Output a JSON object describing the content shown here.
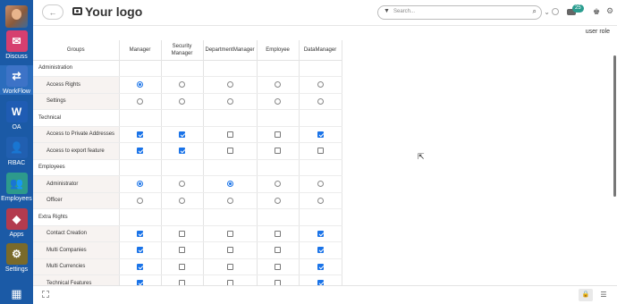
{
  "sidebar": {
    "apps": [
      {
        "label": "Discuss",
        "icon": "discuss-icon",
        "color": "#d63f6f",
        "glyph": "✉"
      },
      {
        "label": "WorkFlow",
        "icon": "workflow-icon",
        "color": "#3d73c7",
        "glyph": "⇄"
      },
      {
        "label": "OA",
        "icon": "word-icon",
        "color": "#1f5cb3",
        "glyph": "W"
      },
      {
        "label": "RBAC",
        "icon": "person-icon",
        "color": "#215fb0",
        "glyph": "👤"
      },
      {
        "label": "Employees",
        "icon": "employees-icon",
        "color": "#2d9a8c",
        "glyph": "👥"
      },
      {
        "label": "Apps",
        "icon": "apps-icon",
        "color": "#b33b4e",
        "glyph": "◆"
      },
      {
        "label": "Settings",
        "icon": "settings-icon",
        "color": "#7a6a2a",
        "glyph": "⚙"
      }
    ]
  },
  "topbar": {
    "logo": "Your logo",
    "search_placeholder": "Search...",
    "badge_count": "25"
  },
  "page": {
    "title": "user role"
  },
  "table": {
    "headers": [
      "Groups",
      "Manager",
      "Security Manager",
      "DepartmentManager",
      "Employee",
      "DataManager"
    ],
    "rows": [
      {
        "label": "Administration",
        "type": "group"
      },
      {
        "label": "Access Rights",
        "type": "radio",
        "values": [
          1,
          0,
          0,
          0,
          0
        ]
      },
      {
        "label": "Settings",
        "type": "radio",
        "values": [
          0,
          0,
          0,
          0,
          0
        ]
      },
      {
        "label": "Technical",
        "type": "group"
      },
      {
        "label": "Access to Private Addresses",
        "type": "check",
        "values": [
          1,
          1,
          0,
          0,
          1
        ]
      },
      {
        "label": "Access to export feature",
        "type": "check",
        "values": [
          1,
          1,
          0,
          0,
          0
        ]
      },
      {
        "label": "Employees",
        "type": "group"
      },
      {
        "label": "Administrator",
        "type": "radio",
        "values": [
          1,
          0,
          1,
          0,
          0
        ]
      },
      {
        "label": "Officer",
        "type": "radio",
        "values": [
          0,
          0,
          0,
          0,
          0
        ]
      },
      {
        "label": "Extra Rights",
        "type": "group"
      },
      {
        "label": "Contact Creation",
        "type": "check",
        "values": [
          1,
          0,
          0,
          0,
          1
        ]
      },
      {
        "label": "Multi Companies",
        "type": "check",
        "values": [
          1,
          0,
          0,
          0,
          1
        ]
      },
      {
        "label": "Multi Currencies",
        "type": "check",
        "values": [
          1,
          0,
          0,
          0,
          1
        ]
      },
      {
        "label": "Technical Features",
        "type": "check",
        "values": [
          1,
          0,
          0,
          0,
          1
        ]
      }
    ]
  }
}
